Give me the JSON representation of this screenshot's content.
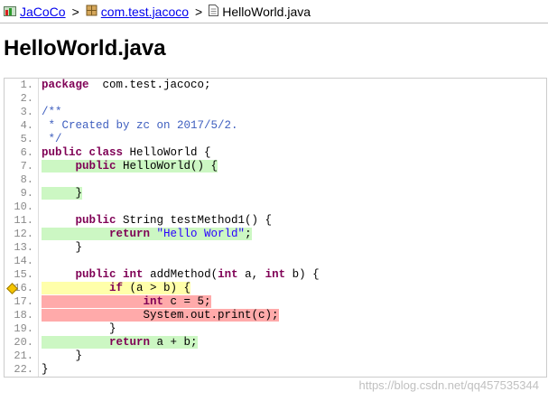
{
  "breadcrumb": {
    "project": "JaCoCo",
    "package": "com.test.jacoco",
    "file": "HelloWorld.java",
    "separator": ">"
  },
  "title": "HelloWorld.java",
  "colors": {
    "fully_covered": "#ccf7c3",
    "not_covered": "#ffaaaa",
    "partly_covered": "#ffffaa"
  },
  "code_lines": [
    {
      "num": "1.",
      "cov": "none",
      "marker": false,
      "tokens": [
        [
          "kw",
          "package"
        ],
        [
          "",
          "  com.test.jacoco;"
        ]
      ]
    },
    {
      "num": "2.",
      "cov": "none",
      "marker": false,
      "tokens": []
    },
    {
      "num": "3.",
      "cov": "none",
      "marker": false,
      "tokens": [
        [
          "cm",
          "/**"
        ]
      ]
    },
    {
      "num": "4.",
      "cov": "none",
      "marker": false,
      "tokens": [
        [
          "cm",
          " * Created by zc on 2017/5/2."
        ]
      ]
    },
    {
      "num": "5.",
      "cov": "none",
      "marker": false,
      "tokens": [
        [
          "cm",
          " */"
        ]
      ]
    },
    {
      "num": "6.",
      "cov": "none",
      "marker": false,
      "tokens": [
        [
          "kw",
          "public"
        ],
        [
          "",
          " "
        ],
        [
          "kw",
          "class"
        ],
        [
          "",
          " HelloWorld {"
        ]
      ]
    },
    {
      "num": "7.",
      "cov": "fc",
      "marker": false,
      "tokens": [
        [
          "",
          "     "
        ],
        [
          "kw",
          "public"
        ],
        [
          "",
          " HelloWorld() {"
        ]
      ]
    },
    {
      "num": "8.",
      "cov": "none",
      "marker": false,
      "tokens": []
    },
    {
      "num": "9.",
      "cov": "fc",
      "marker": false,
      "tokens": [
        [
          "",
          "     }"
        ]
      ]
    },
    {
      "num": "10.",
      "cov": "none",
      "marker": false,
      "tokens": []
    },
    {
      "num": "11.",
      "cov": "none",
      "marker": false,
      "tokens": [
        [
          "",
          "     "
        ],
        [
          "kw",
          "public"
        ],
        [
          "",
          " String testMethod1() {"
        ]
      ]
    },
    {
      "num": "12.",
      "cov": "fc",
      "marker": false,
      "tokens": [
        [
          "",
          "          "
        ],
        [
          "kw",
          "return"
        ],
        [
          "",
          " "
        ],
        [
          "str",
          "\"Hello World\""
        ],
        [
          "",
          ";"
        ]
      ]
    },
    {
      "num": "13.",
      "cov": "none",
      "marker": false,
      "tokens": [
        [
          "",
          "     }"
        ]
      ]
    },
    {
      "num": "14.",
      "cov": "none",
      "marker": false,
      "tokens": []
    },
    {
      "num": "15.",
      "cov": "none",
      "marker": false,
      "tokens": [
        [
          "",
          "     "
        ],
        [
          "kw",
          "public"
        ],
        [
          "",
          " "
        ],
        [
          "kw",
          "int"
        ],
        [
          "",
          " addMethod("
        ],
        [
          "kw",
          "int"
        ],
        [
          "",
          " a, "
        ],
        [
          "kw",
          "int"
        ],
        [
          "",
          " b) {"
        ]
      ]
    },
    {
      "num": "16.",
      "cov": "pc",
      "marker": true,
      "tokens": [
        [
          "",
          "          "
        ],
        [
          "kw",
          "if"
        ],
        [
          "",
          " (a > b) {"
        ]
      ]
    },
    {
      "num": "17.",
      "cov": "nc",
      "marker": false,
      "tokens": [
        [
          "",
          "               "
        ],
        [
          "kw",
          "int"
        ],
        [
          "",
          " c = 5;"
        ]
      ]
    },
    {
      "num": "18.",
      "cov": "nc",
      "marker": false,
      "tokens": [
        [
          "",
          "               System.out.print(c);"
        ]
      ]
    },
    {
      "num": "19.",
      "cov": "none",
      "marker": false,
      "tokens": [
        [
          "",
          "          }"
        ]
      ]
    },
    {
      "num": "20.",
      "cov": "fc",
      "marker": false,
      "tokens": [
        [
          "",
          "          "
        ],
        [
          "kw",
          "return"
        ],
        [
          "",
          " a + b;"
        ]
      ]
    },
    {
      "num": "21.",
      "cov": "none",
      "marker": false,
      "tokens": [
        [
          "",
          "     }"
        ]
      ]
    },
    {
      "num": "22.",
      "cov": "none",
      "marker": false,
      "tokens": [
        [
          "",
          "}"
        ]
      ]
    }
  ],
  "watermark": "https://blog.csdn.net/qq457535344"
}
